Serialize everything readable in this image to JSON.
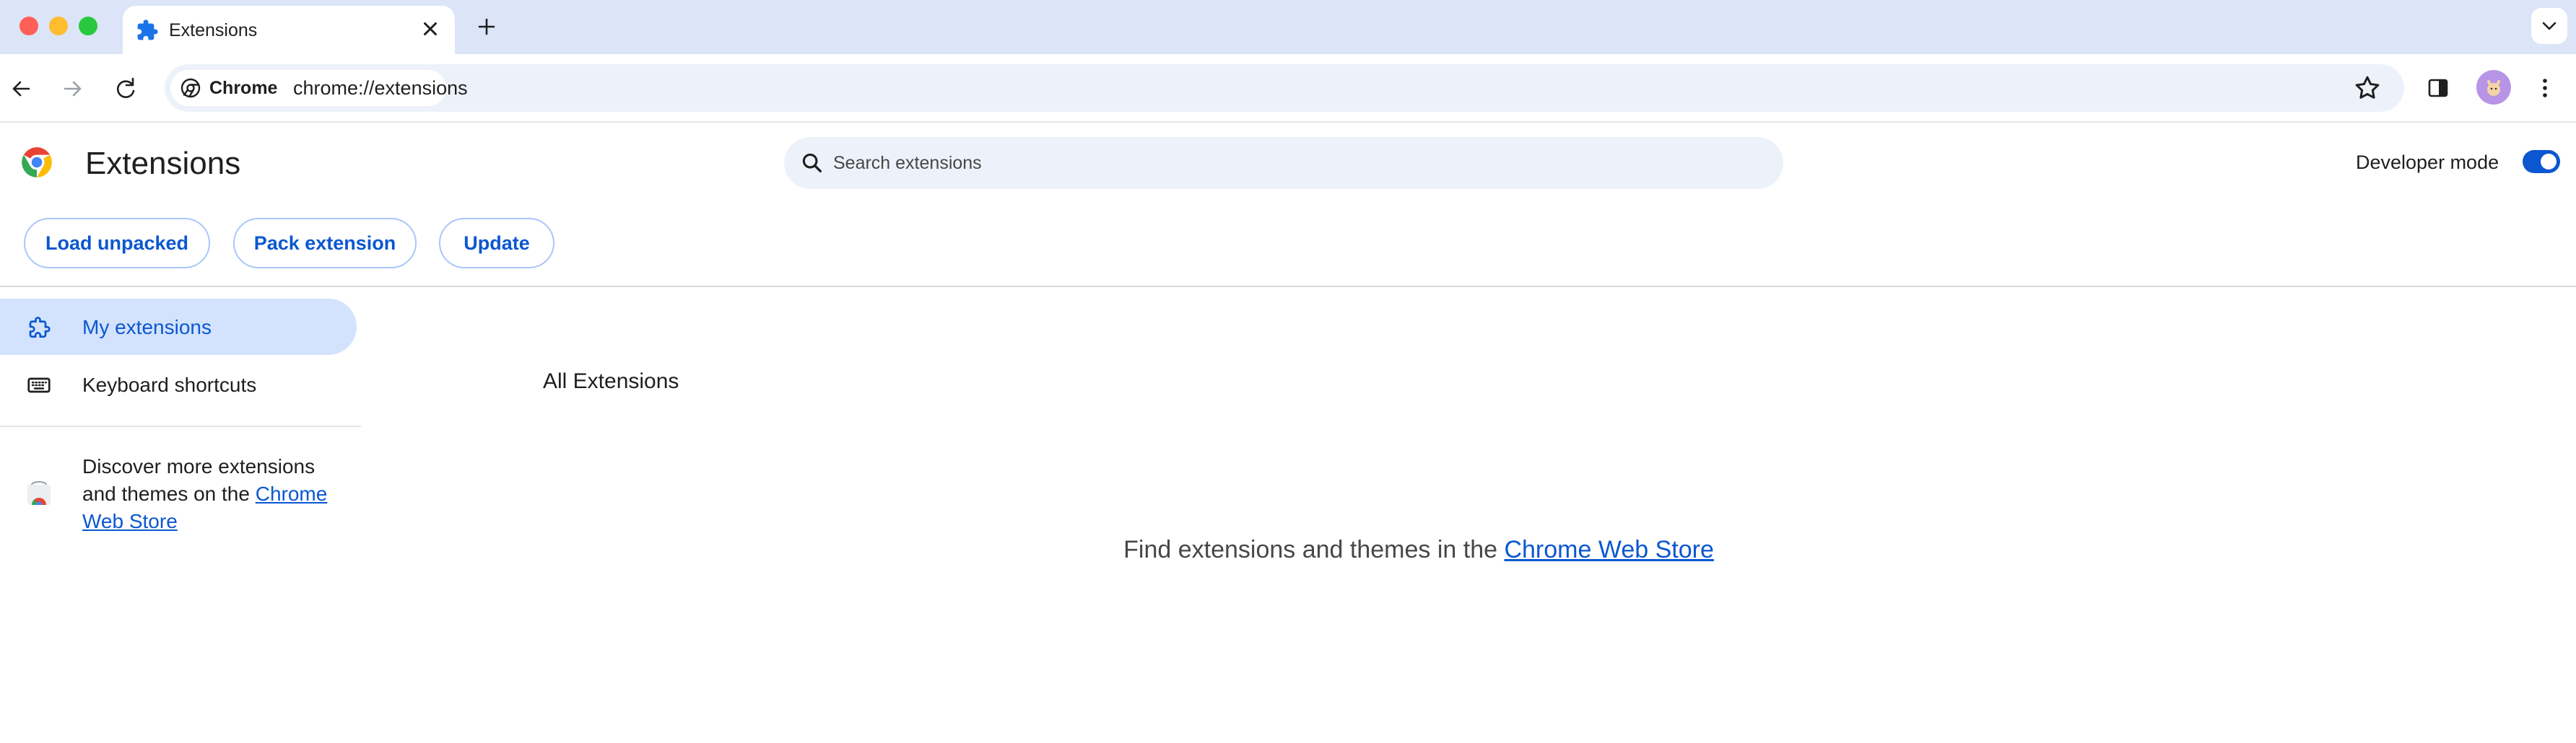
{
  "tab": {
    "title": "Extensions"
  },
  "omnibox": {
    "chip_label": "Chrome",
    "url": "chrome://extensions"
  },
  "header": {
    "title": "Extensions",
    "search_placeholder": "Search extensions",
    "developer_mode_label": "Developer mode",
    "developer_mode_on": true
  },
  "actions": {
    "load_unpacked": "Load unpacked",
    "pack_extension": "Pack extension",
    "update": "Update"
  },
  "sidebar": {
    "items": [
      {
        "label": "My extensions",
        "icon": "puzzle-icon",
        "active": true
      },
      {
        "label": "Keyboard shortcuts",
        "icon": "keyboard-icon",
        "active": false
      }
    ],
    "discover_text": "Discover more extensions and themes on the ",
    "discover_link": "Chrome Web Store"
  },
  "main": {
    "section_title": "All Extensions",
    "empty_text": "Find extensions and themes in the ",
    "empty_link": "Chrome Web Store"
  },
  "colors": {
    "accent": "#0b57d0",
    "tabstrip": "#dce4f7",
    "active_nav": "#d3e3fd"
  }
}
